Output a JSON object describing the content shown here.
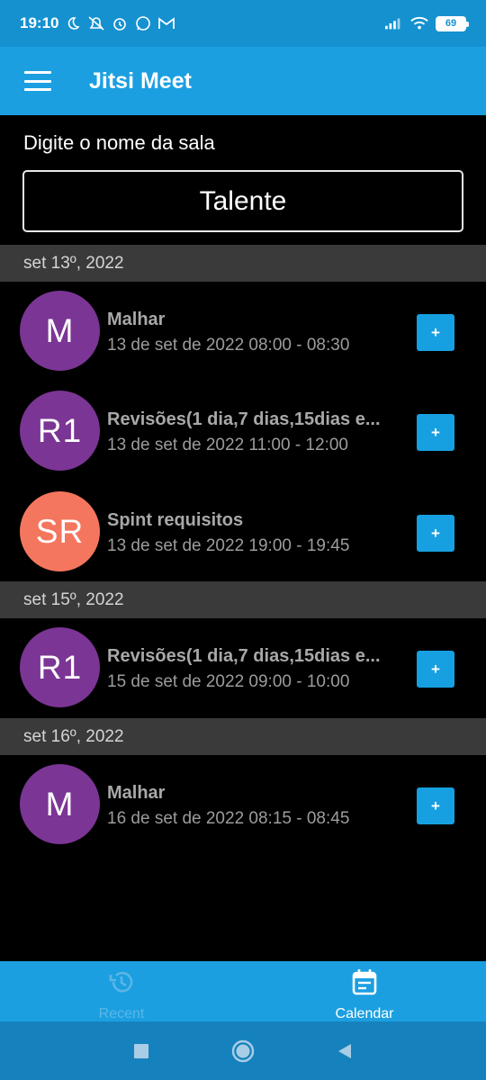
{
  "status_bar": {
    "time": "19:10",
    "battery": "69",
    "icons": [
      "moon-icon",
      "silent-notifications-icon",
      "alarm-icon",
      "whatsapp-icon",
      "gmail-icon",
      "signal-icon",
      "wifi-icon",
      "battery-icon"
    ]
  },
  "app_bar": {
    "menu_icon": "hamburger-menu-icon",
    "title": "Jitsi Meet"
  },
  "room": {
    "label": "Digite o nome da sala",
    "value": "Talente"
  },
  "sections": [
    {
      "date": "set 13º, 2022",
      "events": [
        {
          "initials": "M",
          "color": "#7b3594",
          "title": "Malhar",
          "time": "13 de set de 2022 08:00 - 08:30",
          "action": "+"
        },
        {
          "initials": "R1",
          "color": "#7b3594",
          "title": "Revisões(1 dia,7 dias,15dias e...",
          "time": "13 de set de 2022 11:00 - 12:00",
          "action": "+"
        },
        {
          "initials": "SR",
          "color": "#f5765e",
          "title": "Spint requisitos",
          "time": "13 de set de 2022 19:00 - 19:45",
          "action": "+"
        }
      ]
    },
    {
      "date": "set 15º, 2022",
      "events": [
        {
          "initials": "R1",
          "color": "#7b3594",
          "title": "Revisões(1 dia,7 dias,15dias e...",
          "time": "15 de set de 2022 09:00 - 10:00",
          "action": "+"
        }
      ]
    },
    {
      "date": "set 16º, 2022",
      "events": [
        {
          "initials": "M",
          "color": "#7b3594",
          "title": "Malhar",
          "time": "16 de set de 2022 08:15 - 08:45",
          "action": "+"
        }
      ]
    }
  ],
  "tabs": [
    {
      "label": "Recent",
      "icon": "history-icon",
      "active": false
    },
    {
      "label": "Calendar",
      "icon": "calendar-icon",
      "active": true
    }
  ],
  "nav_bar": {
    "icons": [
      "recents-square-icon",
      "home-circle-icon",
      "back-triangle-icon"
    ]
  },
  "colors": {
    "status_bar": "#1591d0",
    "app_bar": "#1c9fe1",
    "accent": "#17a0e1",
    "section_header": "#3a3a3a",
    "background": "#000000"
  }
}
